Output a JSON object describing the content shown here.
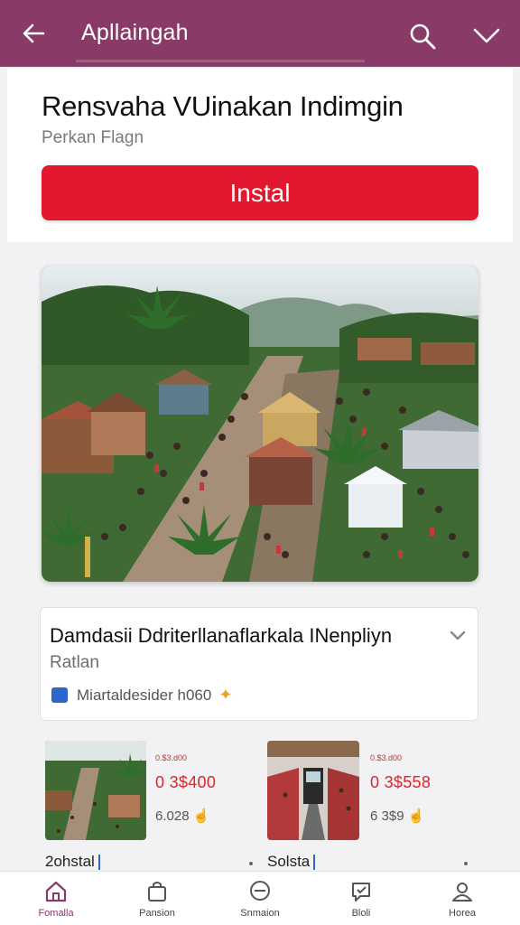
{
  "appbar": {
    "title": "Apllaingah",
    "icons": [
      "back-arrow-icon",
      "search-icon",
      "chevron-down-icon"
    ]
  },
  "header": {
    "app_name": "Rensvaha VUinakan Indimgin",
    "publisher": "Perkan Flagn",
    "install_label": "Instal",
    "install_color": "#e2182f"
  },
  "info": {
    "title": "Damdasii Ddriterllanaflarkala INenpliyn",
    "subtitle": "Ratlan",
    "meta": "Miartaldesider h060",
    "meta_icon": "clap-icon"
  },
  "items": [
    {
      "price_small": "0.$3.d00",
      "price": "0 3$400",
      "count": "6.028",
      "caption": "2ohstal"
    },
    {
      "price_small": "0.$3.d00",
      "price": "0 3$558",
      "count": "6 3$9",
      "caption": "Solsta"
    }
  ],
  "nav": [
    {
      "label": "Fomalla",
      "icon": "home-icon"
    },
    {
      "label": "Pansion",
      "icon": "bag-icon"
    },
    {
      "label": "Snmaion",
      "icon": "chat-icon"
    },
    {
      "label": "Bloli",
      "icon": "message-icon"
    },
    {
      "label": "Horea",
      "icon": "profile-icon"
    }
  ],
  "colors": {
    "appbar": "#8a3a66",
    "accent_red": "#e2182f",
    "active_nav": "#8a3a66"
  }
}
